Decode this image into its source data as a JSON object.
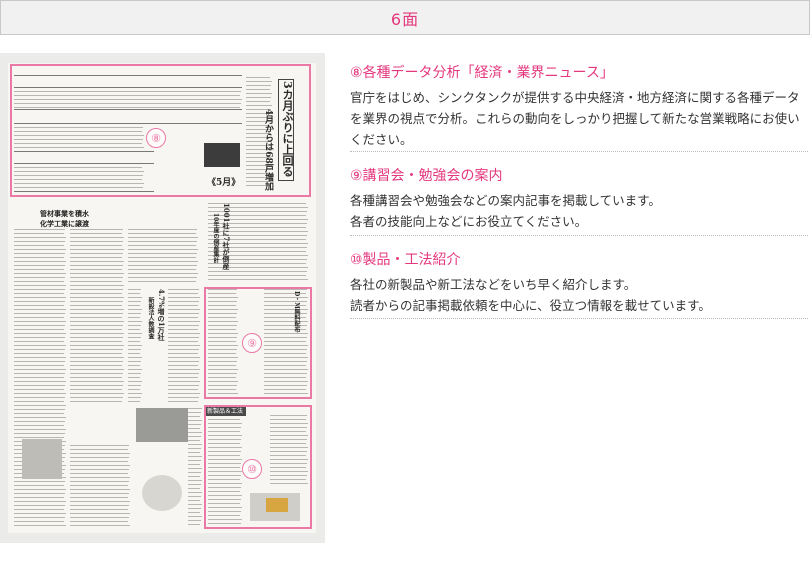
{
  "page": {
    "title": "6面"
  },
  "newspaper": {
    "headline_main": "3カ月ぶりに上回る",
    "headline_sub": "4月からは68戸増加",
    "headline_note": "《5月》",
    "headline_mid": "1001社に7社が倒産",
    "headline_mid2": "10年度の倒産集計",
    "headline_left1": "管材事業を積水",
    "headline_left2": "化学工業に譲渡",
    "headline_c1": "4.7%増の1万社",
    "headline_c2": "新設法人数調査",
    "headline_r1": "D・M無料配布",
    "section_label": "新製品＆工法",
    "markers": [
      "⑧",
      "⑨",
      "⑩"
    ]
  },
  "sections": [
    {
      "title": "⑧各種データ分析「経済・業界ニュース」",
      "lines": [
        "官庁をはじめ、シンクタンクが提供する中央経済・地方経済に関する各種データ",
        "を業界の視点で分析。これらの動向をしっかり把握して新たな営業戦略にお使い",
        "ください。"
      ]
    },
    {
      "title": "⑨講習会・勉強会の案内",
      "lines": [
        "各種講習会や勉強会などの案内記事を掲載しています。",
        "各者の技能向上などにお役立てください。"
      ]
    },
    {
      "title": "⑩製品・工法紹介",
      "lines": [
        "各社の新製品や新工法などをいち早く紹介します。",
        "読者からの記事掲載依頼を中心に、役立つ情報を載せています。"
      ]
    }
  ]
}
